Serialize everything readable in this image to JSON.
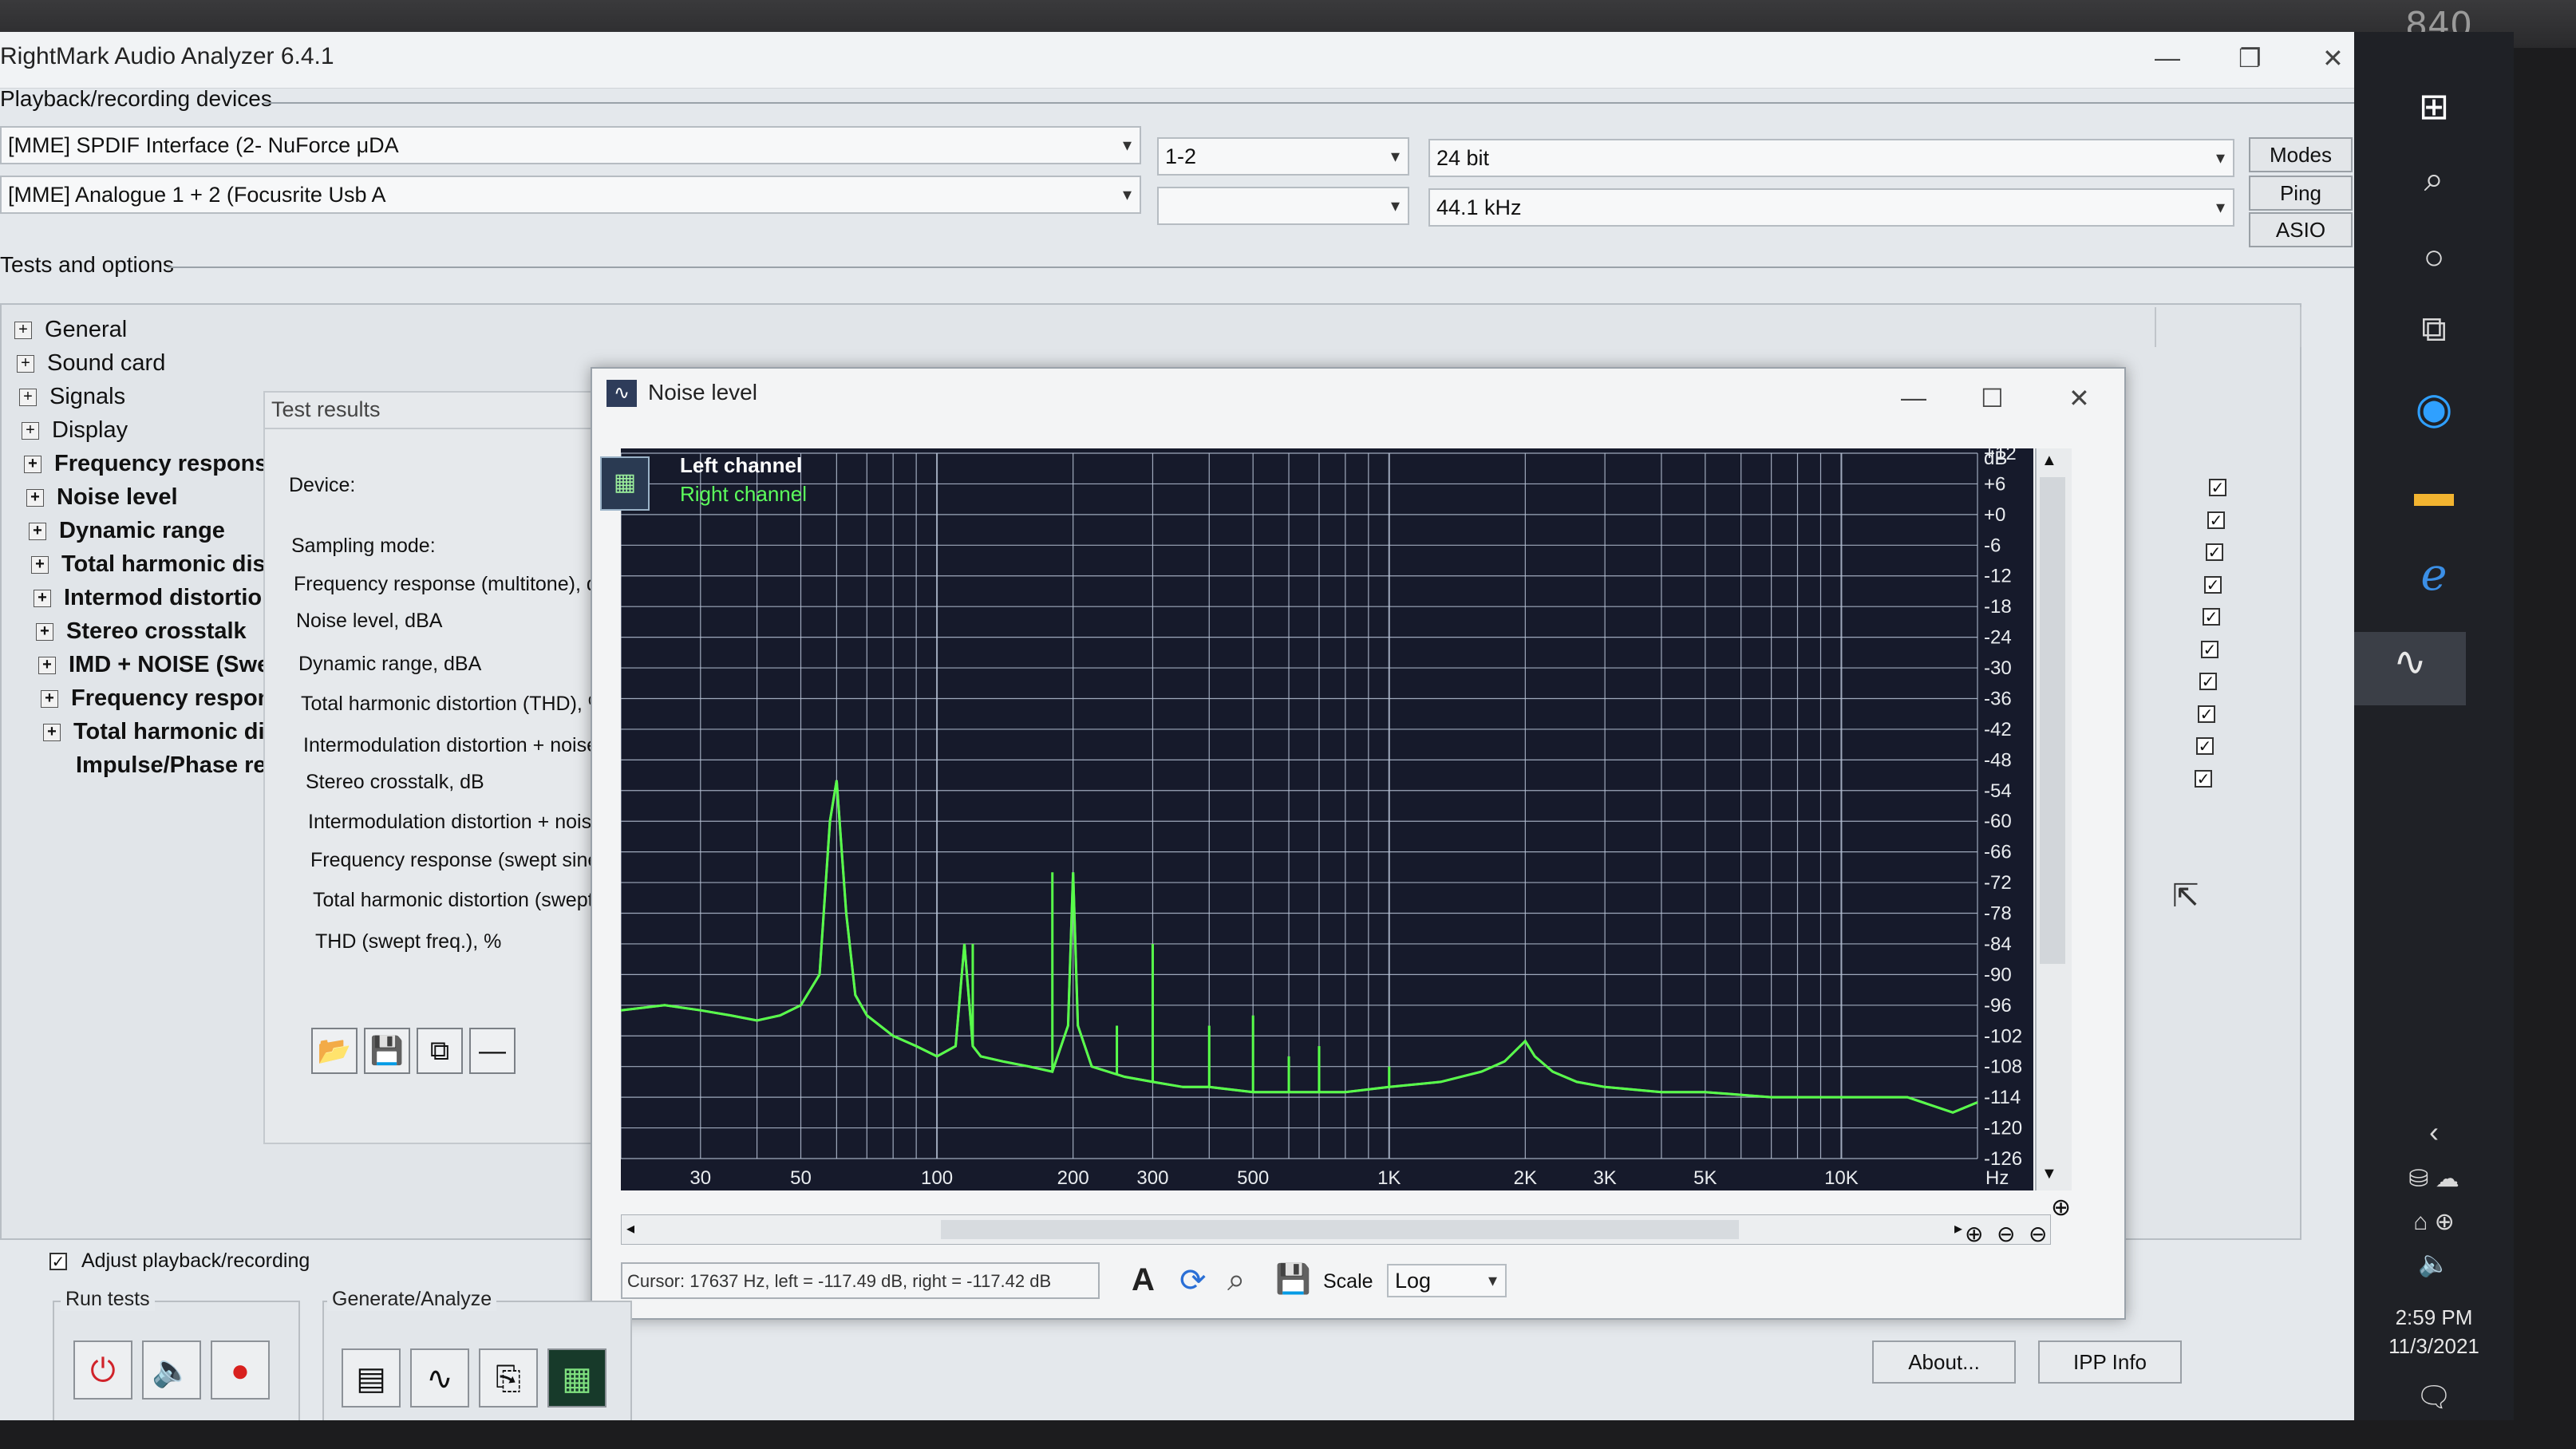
{
  "monitor": {
    "model_number": "840"
  },
  "app": {
    "title": "RightMark Audio Analyzer 6.4.1"
  },
  "devices": {
    "section_label": "Playback/recording devices",
    "playback_device": "[MME] SPDIF Interface (2- NuForce μDA",
    "recording_device": "[MME] Analogue 1 + 2 (Focusrite Usb A",
    "channels": "1-2",
    "channels_rec": "",
    "bit_depth": "24 bit",
    "sample_rate": "44.1 kHz",
    "buttons": {
      "modes": "Modes",
      "ping": "Ping",
      "asio": "ASIO"
    }
  },
  "tests": {
    "section_label": "Tests and options",
    "tree": [
      {
        "label": "General",
        "bold": false
      },
      {
        "label": "Sound card",
        "bold": false
      },
      {
        "label": "Signals",
        "bold": false
      },
      {
        "label": "Display",
        "bold": false
      },
      {
        "label": "Frequency respons",
        "bold": true
      },
      {
        "label": "Noise level",
        "bold": true
      },
      {
        "label": "Dynamic range",
        "bold": true
      },
      {
        "label": "Total harmonic dist",
        "bold": true
      },
      {
        "label": "Intermod distortio",
        "bold": true
      },
      {
        "label": "Stereo crosstalk",
        "bold": true
      },
      {
        "label": "IMD + NOISE (Swe",
        "bold": true
      },
      {
        "label": "Frequency respons",
        "bold": true
      },
      {
        "label": "Total harmonic dis",
        "bold": true
      },
      {
        "label": "Impulse/Phase res",
        "bold": true
      }
    ],
    "checked_count": 10
  },
  "results": {
    "title": "Test results",
    "rows": [
      "Device:",
      "Sampling mode:",
      "Frequency response (multitone), dB",
      "Noise level, dBA",
      "Dynamic range, dBA",
      "Total harmonic distortion (THD), %",
      "Intermodulation distortion + noise, %",
      "Stereo crosstalk, dB",
      "Intermodulation distortion + noise (s",
      "Frequency response (swept sine), d",
      "Total harmonic distortion (swept fre",
      "THD (swept freq.), %"
    ]
  },
  "noise_window": {
    "title": "Noise level",
    "legend": {
      "left": "Left channel",
      "right": "Right channel"
    },
    "status": {
      "cursor": "Cursor:  17637 Hz,  left = -117.49 dB,  right = -117.42 dB",
      "scale_label": "Scale",
      "scale_value": "Log"
    },
    "colors": {
      "plot_bg": "#161a2b",
      "grid": "#b8c3d6",
      "left": "#f2f2f2",
      "right": "#58ff4a"
    }
  },
  "chart_data": {
    "type": "line",
    "title": "",
    "xlabel": "Hz",
    "ylabel": "dB",
    "xscale": "log",
    "xlim": [
      20,
      20000
    ],
    "ylim": [
      -126,
      12
    ],
    "x_tick_labels": [
      "30",
      "50",
      "100",
      "200",
      "300",
      "500",
      "1K",
      "2K",
      "3K",
      "5K",
      "10K"
    ],
    "x_tick_values": [
      30,
      50,
      100,
      200,
      300,
      500,
      1000,
      2000,
      3000,
      5000,
      10000
    ],
    "y_tick_labels": [
      "+12",
      "+6",
      "+0",
      "-6",
      "-12",
      "-18",
      "-24",
      "-30",
      "-36",
      "-42",
      "-48",
      "-54",
      "-60",
      "-66",
      "-72",
      "-78",
      "-84",
      "-90",
      "-96",
      "-102",
      "-108",
      "-114",
      "-120",
      "-126"
    ],
    "y_tick_values": [
      12,
      6,
      0,
      -6,
      -12,
      -18,
      -24,
      -30,
      -36,
      -42,
      -48,
      -54,
      -60,
      -66,
      -72,
      -78,
      -84,
      -90,
      -96,
      -102,
      -108,
      -114,
      -120,
      -126
    ],
    "grid": true,
    "series": [
      {
        "name": "Right channel",
        "x": [
          20,
          25,
          30,
          35,
          40,
          45,
          50,
          55,
          58,
          60,
          63,
          66,
          70,
          80,
          90,
          100,
          110,
          115,
          120,
          125,
          140,
          160,
          180,
          195,
          200,
          205,
          220,
          260,
          300,
          350,
          400,
          500,
          600,
          800,
          1000,
          1300,
          1600,
          1800,
          2000,
          2100,
          2300,
          2600,
          3000,
          4000,
          5000,
          7000,
          10000,
          14000,
          17637,
          20000
        ],
        "y": [
          -97,
          -96,
          -97,
          -98,
          -99,
          -98,
          -96,
          -90,
          -60,
          -52,
          -78,
          -94,
          -98,
          -102,
          -104,
          -106,
          -104,
          -84,
          -104,
          -106,
          -107,
          -108,
          -109,
          -100,
          -70,
          -100,
          -108,
          -110,
          -111,
          -112,
          -112,
          -113,
          -113,
          -113,
          -112,
          -111,
          -109,
          -107,
          -103,
          -106,
          -109,
          -111,
          -112,
          -113,
          -113,
          -114,
          -114,
          -114,
          -117,
          -115
        ]
      }
    ],
    "spikes": {
      "x": [
        60,
        120,
        180,
        250,
        300,
        400,
        500,
        600,
        700,
        1000
      ],
      "y": [
        -52,
        -84,
        -70,
        -100,
        -84,
        -100,
        -98,
        -106,
        -104,
        -108
      ]
    }
  },
  "bottom": {
    "adjust_label": "Adjust playback/recording",
    "run_tests_label": "Run tests",
    "generate_label": "Generate/Analyze",
    "about": "About...",
    "ipp": "IPP Info"
  },
  "taskbar": {
    "time": "2:59 PM",
    "date": "11/3/2021"
  }
}
